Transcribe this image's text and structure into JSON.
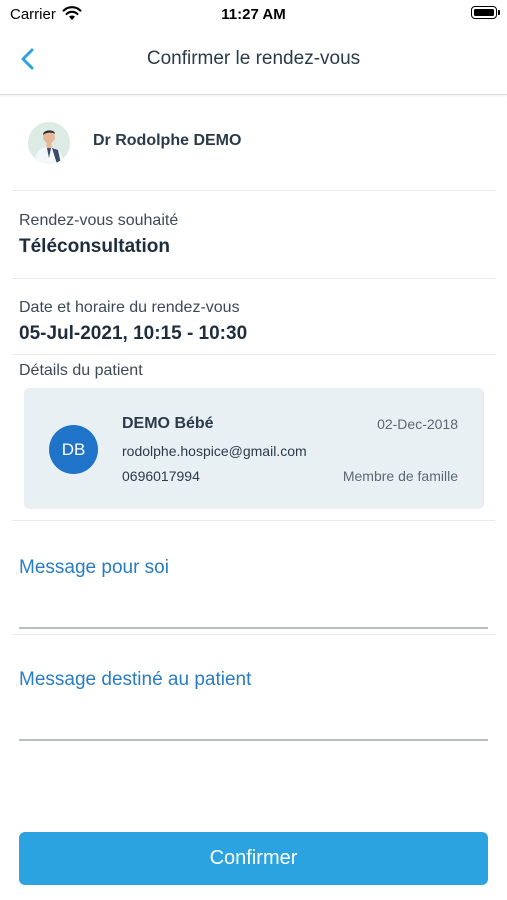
{
  "status_bar": {
    "carrier": "Carrier",
    "time": "11:27 AM"
  },
  "nav": {
    "title": "Confirmer le rendez-vous",
    "back_icon": "chevron-left-icon"
  },
  "doctor": {
    "name": "Dr Rodolphe DEMO"
  },
  "appointment": {
    "type_label": "Rendez-vous souhaité",
    "type_value": "Téléconsultation",
    "datetime_label": "Date et horaire du rendez-vous",
    "datetime_value": "05-Jul-2021, 10:15 - 10:30"
  },
  "patient": {
    "section_label": "Détails du patient",
    "initials": "DB",
    "name": "DEMO Bébé",
    "birth_date": "02-Dec-2018",
    "email": "rodolphe.hospice@gmail.com",
    "phone": "0696017994",
    "relation": "Membre de famille"
  },
  "messages": {
    "self_label": "Message pour soi",
    "patient_label": "Message destiné au patient"
  },
  "actions": {
    "confirm_label": "Confirmer"
  },
  "colors": {
    "accent": "#2ba3e1",
    "link": "#2a7cc0",
    "avatar": "#1f73c8",
    "card_bg": "#e8f0f4"
  }
}
